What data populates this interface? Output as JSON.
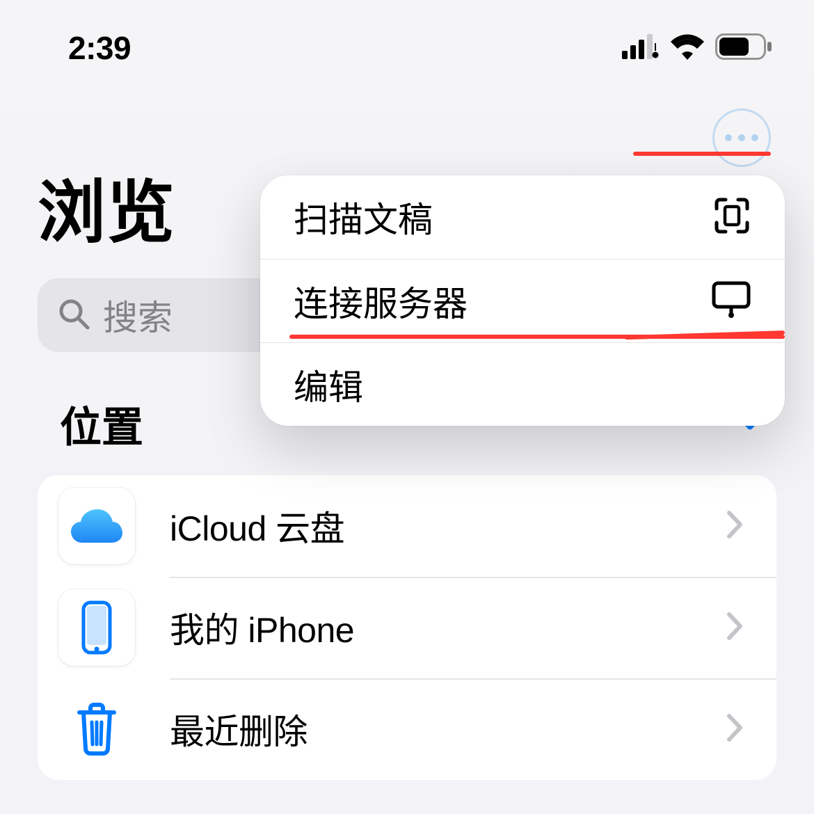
{
  "status": {
    "time": "2:39"
  },
  "page_title": "浏览",
  "search": {
    "placeholder": "搜索"
  },
  "section": {
    "title": "位置"
  },
  "locations": [
    {
      "label": "iCloud 云盘",
      "icon": "cloud"
    },
    {
      "label": "我的 iPhone",
      "icon": "phone"
    },
    {
      "label": "最近删除",
      "icon": "trash"
    }
  ],
  "menu": [
    {
      "label": "扫描文稿",
      "icon": "scan"
    },
    {
      "label": "连接服务器",
      "icon": "server"
    },
    {
      "label": "编辑",
      "icon": ""
    }
  ]
}
